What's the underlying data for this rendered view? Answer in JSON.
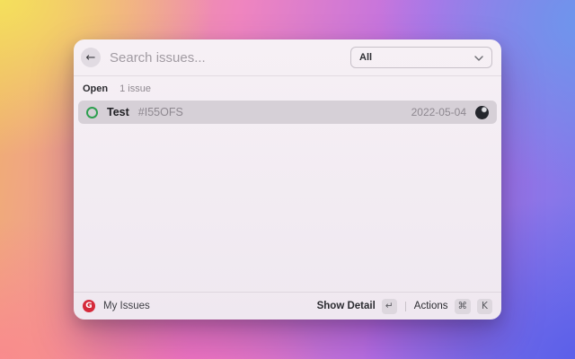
{
  "window": {
    "header": {
      "back_icon": "←",
      "search": {
        "placeholder": "Search issues...",
        "value": ""
      },
      "filter_dropdown": {
        "value": "All"
      }
    },
    "section": {
      "status_label": "Open",
      "count_label": "1 issue"
    },
    "issues": [
      {
        "title": "Test",
        "id": "#I55OFS",
        "date": "2022-05-04",
        "state": "open",
        "selected": true
      }
    ],
    "footer": {
      "logo_letter": "G",
      "app_label": "My Issues",
      "show_detail": {
        "label": "Show Detail",
        "key": "↵"
      },
      "actions": {
        "label": "Actions",
        "key_1": "⌘",
        "key_2": "K"
      }
    },
    "colors": {
      "open_status_green": "#2d9f4f",
      "logo_red": "#d5293a",
      "selected_row_bg": "#d6d0d7",
      "modal_bg": "#f2ebf2",
      "backdrop_gradient": [
        "#f4e05c",
        "#f98b8d",
        "#f26fc5",
        "#6d97ec",
        "#5a5ee9"
      ]
    }
  }
}
